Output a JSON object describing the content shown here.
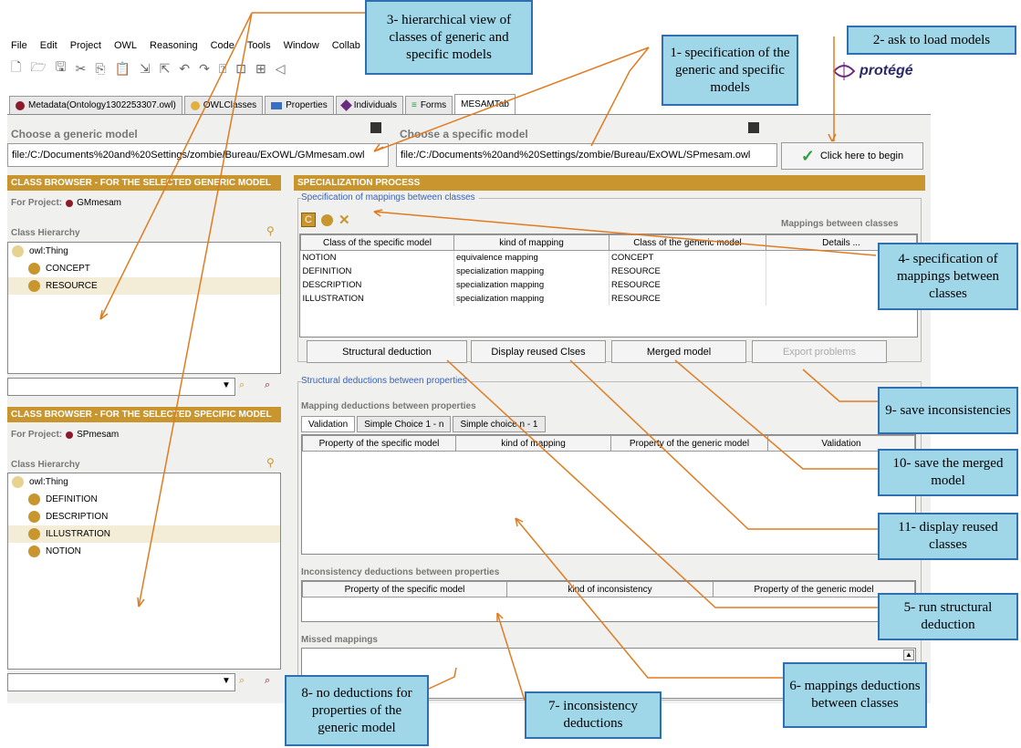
{
  "menu": [
    "File",
    "Edit",
    "Project",
    "OWL",
    "Reasoning",
    "Code",
    "Tools",
    "Window",
    "Collab"
  ],
  "brand": "protégé",
  "tabs": [
    {
      "label": "Metadata(Ontology1302253307.owl)",
      "color": "#8b1a2a"
    },
    {
      "label": "OWLClasses",
      "color": "#e0b03a"
    },
    {
      "label": "Properties",
      "color": "#3a6fc0"
    },
    {
      "label": "Individuals",
      "color": "#6a2a80"
    },
    {
      "label": "Forms",
      "color": "#2aa040"
    },
    {
      "label": "MESAMTab",
      "color": ""
    }
  ],
  "generic_model": {
    "caption": "Choose a generic model",
    "path": "file:/C:/Documents%20and%20Settings/zombie/Bureau/ExOWL/GMmesam.owl"
  },
  "specific_model": {
    "caption": "Choose a specific model",
    "path": "file:/C:/Documents%20and%20Settings/zombie/Bureau/ExOWL/SPmesam.owl"
  },
  "begin_button": "Click here to begin",
  "generic_browser": {
    "header": "CLASS BROWSER - FOR THE SELECTED GENERIC MODEL",
    "project_label": "For Project:",
    "project": "GMmesam",
    "hierarchy_label": "Class Hierarchy",
    "root": "owl:Thing",
    "items": [
      "CONCEPT",
      "RESOURCE"
    ]
  },
  "specific_browser": {
    "header": "CLASS BROWSER - FOR THE SELECTED SPECIFIC MODEL",
    "project_label": "For Project:",
    "project": "SPmesam",
    "hierarchy_label": "Class Hierarchy",
    "root": "owl:Thing",
    "items": [
      "DEFINITION",
      "DESCRIPTION",
      "ILLUSTRATION",
      "NOTION"
    ]
  },
  "process": {
    "header": "SPECIALIZATION PROCESS",
    "spec_group": "Specification of mappings between classes",
    "mappings_title": "Mappings between classes",
    "columns": [
      "Class of the specific model",
      "kind of mapping",
      "Class of the generic model",
      "Details ..."
    ],
    "rows": [
      [
        "NOTION",
        "equivalence mapping",
        "CONCEPT",
        ""
      ],
      [
        "DEFINITION",
        "specialization mapping",
        "RESOURCE",
        ""
      ],
      [
        "DESCRIPTION",
        "specialization mapping",
        "RESOURCE",
        ""
      ],
      [
        "ILLUSTRATION",
        "specialization mapping",
        "RESOURCE",
        ""
      ]
    ],
    "buttons": [
      "Structural deduction",
      "Display reused Clses",
      "Merged model",
      "Export problems"
    ],
    "struct_group": "Structural deductions between properties",
    "mapping_deductions_title": "Mapping deductions between properties",
    "subtabs": [
      "Validation",
      "Simple Choice 1 - n",
      "Simple choice n - 1"
    ],
    "prop_columns": [
      "Property of the specific model",
      "kind of mapping",
      "Property of the generic model",
      "Validation"
    ],
    "inconsistency_title": "Inconsistency deductions between properties",
    "incons_columns": [
      "Property of the specific model",
      "kind of inconsistency",
      "Property of the generic model"
    ],
    "missed_title": "Missed mappings"
  },
  "callouts": {
    "c1": "1- specification of the generic and specific models",
    "c2": "2- ask to load models",
    "c3": "3- hierarchical view of classes of generic and specific models",
    "c4": "4- specification of mappings between classes",
    "c5": "5- run structural deduction",
    "c6": "6- mappings deductions between classes",
    "c7": "7- inconsistency deductions",
    "c8": "8- no deductions for properties of the generic model",
    "c9": "9- save inconsistencies",
    "c10": "10- save the merged model",
    "c11": "11- display reused classes"
  },
  "colors": {
    "accent": "#c8952e",
    "callout_bg": "#9fd6e8",
    "callout_border": "#2f6fb0",
    "arrow": "#e07b20"
  }
}
